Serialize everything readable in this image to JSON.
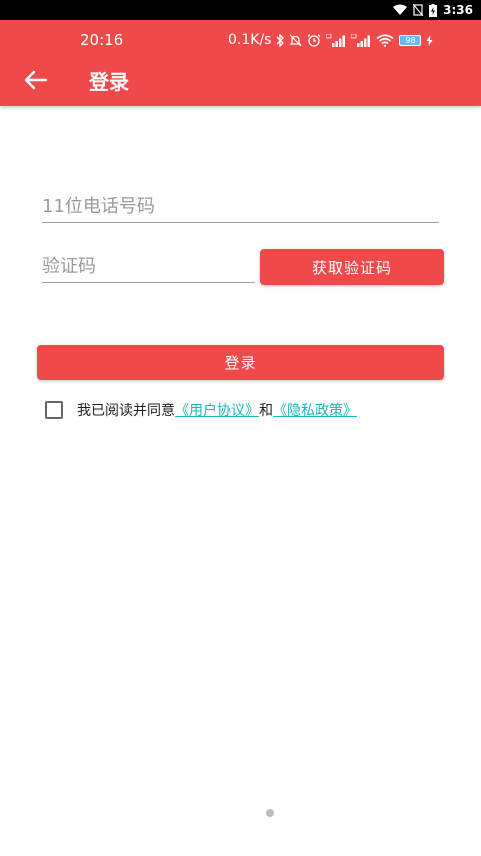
{
  "system_status": {
    "time": "3:36"
  },
  "app_status": {
    "time": "20:16",
    "net_speed": "0.1K/s",
    "battery": "98"
  },
  "header": {
    "title": "登录"
  },
  "form": {
    "phone_placeholder": "11位电话号码",
    "code_placeholder": "验证码",
    "get_code_label": "获取验证码",
    "login_label": "登录"
  },
  "agreement": {
    "prefix": "我已阅读并同意",
    "user_agreement": "《用户协议》",
    "and": "和",
    "privacy_policy": "《隐私政策》"
  },
  "colors": {
    "primary": "#ef4a4a",
    "link": "#1fb8b8"
  },
  "icons": {
    "back": "arrow-left-icon"
  }
}
